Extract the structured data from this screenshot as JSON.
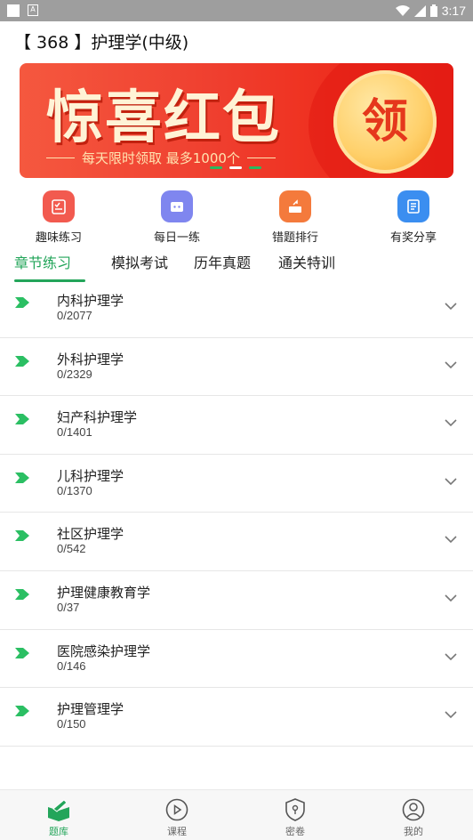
{
  "status_bar": {
    "time": "3:17",
    "icons": [
      "notification-square",
      "sim-card",
      "wifi-icon",
      "signal-icon",
      "battery-icon"
    ]
  },
  "header": {
    "title": "【 368 】护理学(中级)"
  },
  "banner": {
    "headline": "惊喜红包",
    "subtitle": "每天限时领取  最多1000个",
    "coin_text": "领",
    "slide_count": 3,
    "active_slide": 2
  },
  "quick_menu": [
    {
      "label": "趣味练习",
      "icon": "quiz-icon",
      "color": "#f25a4f"
    },
    {
      "label": "每日一练",
      "icon": "daily-icon",
      "color": "#7f86ef"
    },
    {
      "label": "错题排行",
      "icon": "ranking-icon",
      "color": "#f47a3c"
    },
    {
      "label": "有奖分享",
      "icon": "share-icon",
      "color": "#3b8ef0"
    }
  ],
  "tabs": [
    {
      "label": "章节练习",
      "active": true
    },
    {
      "label": "模拟考试",
      "active": false
    },
    {
      "label": "历年真题",
      "active": false
    },
    {
      "label": "通关特训",
      "active": false
    }
  ],
  "chapters": [
    {
      "name": "内科护理学",
      "progress": "0/2077"
    },
    {
      "name": "外科护理学",
      "progress": "0/2329"
    },
    {
      "name": "妇产科护理学",
      "progress": "0/1401"
    },
    {
      "name": "儿科护理学",
      "progress": "0/1370"
    },
    {
      "name": "社区护理学",
      "progress": "0/542"
    },
    {
      "name": "护理健康教育学",
      "progress": "0/37"
    },
    {
      "name": "医院感染护理学",
      "progress": "0/146"
    },
    {
      "name": "护理管理学",
      "progress": "0/150"
    }
  ],
  "bottom_nav": [
    {
      "label": "题库",
      "icon": "question-bank-icon",
      "active": true
    },
    {
      "label": "课程",
      "icon": "play-course-icon",
      "active": false
    },
    {
      "label": "密卷",
      "icon": "secret-paper-icon",
      "active": false
    },
    {
      "label": "我的",
      "icon": "profile-icon",
      "active": false
    }
  ],
  "colors": {
    "accent": "#23a55a",
    "banner_red": "#ef3322",
    "coin_gold": "#ffd06a"
  }
}
